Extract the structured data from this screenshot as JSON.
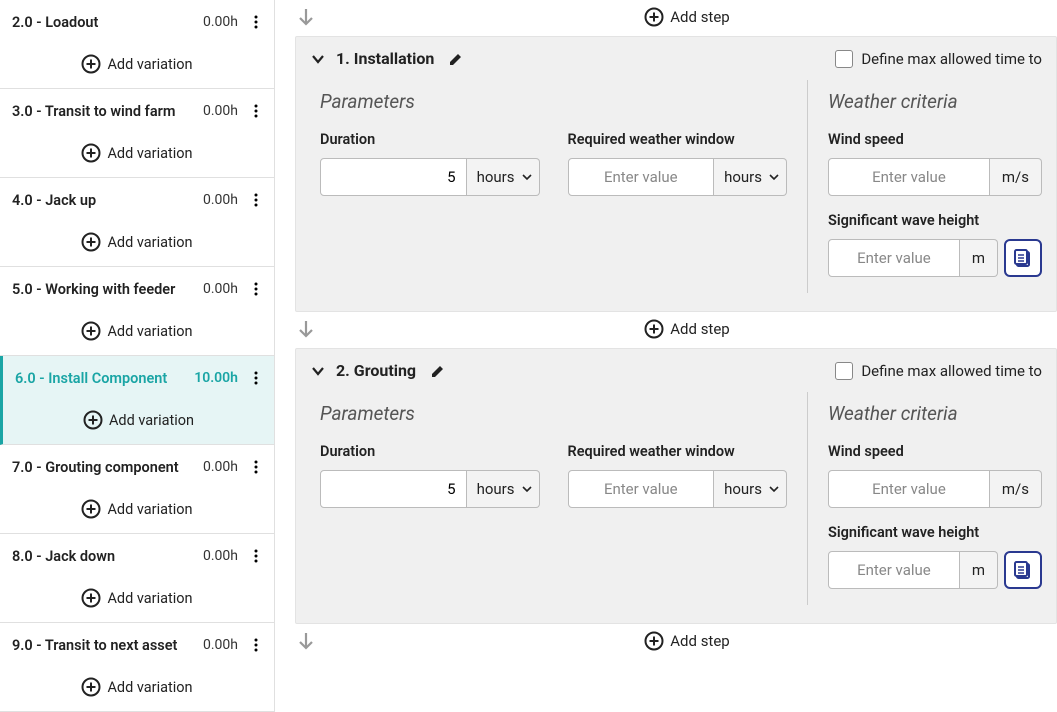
{
  "sidebar": {
    "add_variation_label": "Add variation",
    "items": [
      {
        "title": "2.0 - Loadout",
        "hours": "0.00h",
        "active": false
      },
      {
        "title": "3.0 - Transit to wind farm",
        "hours": "0.00h",
        "active": false
      },
      {
        "title": "4.0 - Jack up",
        "hours": "0.00h",
        "active": false
      },
      {
        "title": "5.0 - Working with feeder",
        "hours": "0.00h",
        "active": false
      },
      {
        "title": "6.0 - Install Component",
        "hours": "10.00h",
        "active": true
      },
      {
        "title": "7.0 - Grouting component",
        "hours": "0.00h",
        "active": false
      },
      {
        "title": "8.0 - Jack down",
        "hours": "0.00h",
        "active": false
      },
      {
        "title": "9.0 - Transit to next asset",
        "hours": "0.00h",
        "active": false
      }
    ]
  },
  "main": {
    "add_step_label": "Add step",
    "define_max_label": "Define max allowed time to",
    "parameters_label": "Parameters",
    "weather_label": "Weather criteria",
    "duration_label": "Duration",
    "window_label": "Required weather window",
    "wind_label": "Wind speed",
    "wave_label": "Significant wave height",
    "hours_unit": "hours",
    "ms_unit": "m/s",
    "m_unit": "m",
    "enter_value": "Enter value",
    "steps": [
      {
        "title": "1. Installation",
        "duration": "5"
      },
      {
        "title": "2. Grouting",
        "duration": "5"
      }
    ]
  }
}
